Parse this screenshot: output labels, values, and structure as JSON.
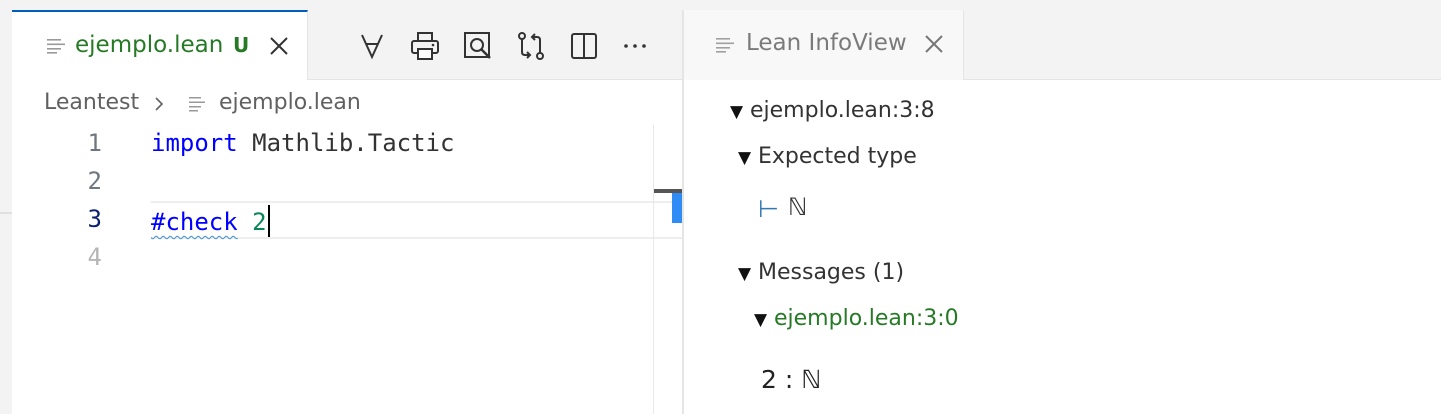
{
  "editor": {
    "tab": {
      "title": "ejemplo.lean",
      "status": "U",
      "icon": "lines-icon",
      "close_icon": "close-icon"
    },
    "toolbar_icons": [
      "forall-icon",
      "print-icon",
      "search-preview-icon",
      "git-compare-icon",
      "split-editor-icon",
      "more-actions-icon"
    ],
    "breadcrumb": {
      "project": "Leantest",
      "file": "ejemplo.lean"
    },
    "lines": [
      {
        "number": "1",
        "keyword": "import",
        "rest": " Mathlib.Tactic"
      },
      {
        "number": "2"
      },
      {
        "number": "3",
        "keyword": "#check",
        "number_token": "2"
      },
      {
        "number": "4"
      }
    ],
    "current_line": "3"
  },
  "infoview": {
    "tab": {
      "title": "Lean InfoView",
      "icon": "lines-icon",
      "close_icon": "close-icon"
    },
    "location": "ejemplo.lean:3:8",
    "expected_type": {
      "label": "Expected type",
      "turnstile": "⊢",
      "type": "ℕ"
    },
    "messages": {
      "label": "Messages (1)",
      "location": "ejemplo.lean:3:0",
      "result": "2 : ℕ"
    },
    "triangle_glyph": "▼"
  },
  "colors": {
    "accent": "#005fb8",
    "git_untracked": "#267a26",
    "keyword": "#0000ff",
    "number": "#098658",
    "turnstile": "#3278b4"
  }
}
